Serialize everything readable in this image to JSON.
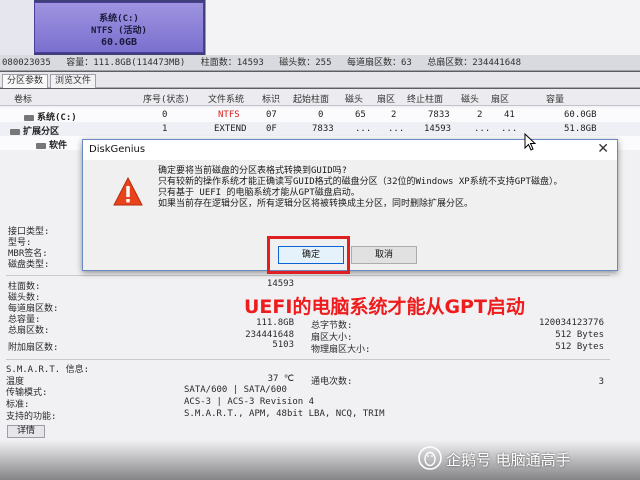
{
  "disk_map": {
    "partition_name": "系统(C:)",
    "fs": "NTFS (活动)",
    "size": "60.0GB"
  },
  "disk_info": {
    "id": "080023035",
    "capacity": "容量：111.8GB(114473MB)",
    "cylinders": "柱面数：14593",
    "heads": "磁头数：255",
    "sectors_per_track": "每道扇区数：63",
    "total_sectors": "总扇区数：234441648"
  },
  "tabs": [
    {
      "label": "分区参数"
    },
    {
      "label": "浏览文件"
    }
  ],
  "partition_table": {
    "headers": [
      "卷标",
      "序号(状态)",
      "文件系统",
      "标识",
      "起始柱面",
      "磁头",
      "扇区",
      "终止柱面",
      "磁头",
      "扇区",
      "容量"
    ],
    "rows": [
      {
        "label": "系统(C:)",
        "index": "0",
        "fs": "NTFS",
        "id": "07",
        "start_cyl": "0",
        "start_head": "65",
        "start_sec": "2",
        "end_cyl": "7833",
        "end_head": "2",
        "end_sec": "41",
        "size": "60.0GB"
      },
      {
        "label": "扩展分区",
        "index": "1",
        "fs": "EXTEND",
        "id": "0F",
        "start_cyl": "7833",
        "start_head": "...",
        "start_sec": "...",
        "end_cyl": "14593",
        "end_head": "...",
        "end_sec": "...",
        "size": "51.8GB"
      },
      {
        "label": "软件"
      }
    ]
  },
  "details": {
    "interface_label": "接口类型:",
    "model_label": "型号:",
    "mbr_sig_label": "MBR签名:",
    "disk_type_label": "磁盘类型:",
    "cyl_label": "柱面数:",
    "cyl_value": "14593",
    "heads_label": "磁头数:",
    "spt_label": "每道扇区数:",
    "capacity_label": "总容量:",
    "capacity_value": "111.8GB",
    "total_sec_label": "总扇区数:",
    "total_sec_value": "234441648",
    "extra_sec_label": "附加扇区数:",
    "extra_sec_value": "5103",
    "total_bytes_label": "总字节数:",
    "total_bytes_value": "120034123776",
    "sector_size_label": "扇区大小:",
    "sector_size_value": "512 Bytes",
    "phys_sector_label": "物理扇区大小:",
    "phys_sector_value": "512 Bytes",
    "smart_label": "S.M.A.R.T. 信息:",
    "temp_label": "温度",
    "temp_value": "37 ℃",
    "power_label": "通电次数:",
    "power_value": "3",
    "transfer_label": "传输模式:",
    "transfer_value": "SATA/600 | SATA/600",
    "standard_label": "标准:",
    "standard_value": "ACS-3 | ACS-3 Revision 4",
    "features_label": "支持的功能:",
    "features_value": "S.M.A.R.T., APM, 48bit LBA, NCQ, TRIM",
    "detail_button": "详情"
  },
  "dialog": {
    "title": "DiskGenius",
    "close_glyph": "✕",
    "lines": [
      "确定要将当前磁盘的分区表格式转换到GUID吗?",
      "只有较新的操作系统才能正确读写GUID格式的磁盘分区（32位的Windows XP系统不支持GPT磁盘）。",
      "只有基于 UEFI 的电脑系统才能从GPT磁盘启动。",
      "如果当前存在逻辑分区，所有逻辑分区将被转换成主分区，同时删除扩展分区。"
    ],
    "ok_label": "确定",
    "cancel_label": "取消"
  },
  "annotation": "UEFI的电脑系统才能从GPT启动",
  "watermark": "企鹅号 电脑通高手",
  "colors": {
    "partition_fill": "#8d83d8",
    "highlight_red": "#e02020",
    "annotation_red": "#ee1c1c",
    "warning_orange": "#e8431a"
  }
}
